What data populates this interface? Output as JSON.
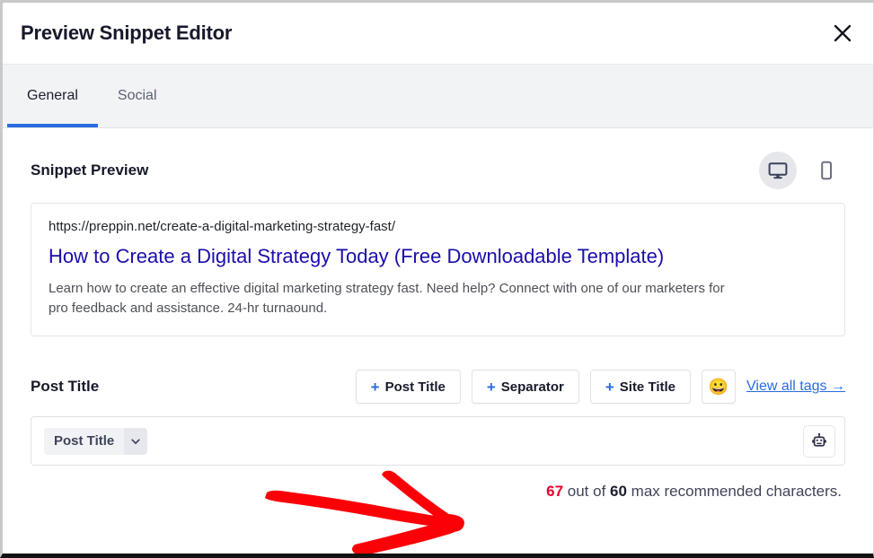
{
  "header": {
    "title": "Preview Snippet Editor",
    "close_icon": "close-icon"
  },
  "tabs": [
    {
      "label": "General",
      "active": true
    },
    {
      "label": "Social",
      "active": false
    }
  ],
  "preview_section": {
    "title": "Snippet Preview",
    "devices": [
      {
        "name": "desktop-icon",
        "label": "Desktop",
        "active": true
      },
      {
        "name": "mobile-icon",
        "label": "Mobile",
        "active": false
      }
    ],
    "snippet": {
      "url": "https://preppin.net/create-a-digital-marketing-strategy-fast/",
      "title": "How to Create a Digital Strategy Today (Free Downloadable Template)",
      "description": "Learn how to create an effective digital marketing strategy fast. Need help? Connect with one of our marketers for pro feedback and assistance. 24-hr turnaound."
    }
  },
  "field": {
    "label": "Post Title",
    "buttons": [
      {
        "plus": "+",
        "label": "Post Title"
      },
      {
        "plus": "+",
        "label": "Separator"
      },
      {
        "plus": "+",
        "label": "Site Title"
      }
    ],
    "emoji_button": "😀",
    "view_all_tags": "View all tags →",
    "chip": {
      "label": "Post Title",
      "caret_icon": "chevron-down-icon"
    },
    "ai_button_icon": "robot-icon"
  },
  "counter": {
    "count": "67",
    "middle": " out of ",
    "max": "60",
    "suffix": " max recommended characters."
  },
  "colors": {
    "accent_blue": "#2a6ce0",
    "link_blue": "#1a0dab",
    "over_limit_red": "#e3002b",
    "annotation_red": "#fb0007",
    "tab_bar_bg": "#f2f3f5",
    "title_navy": "#17192b"
  },
  "annotation": {
    "shape": "hand-drawn-arrow",
    "direction": "right",
    "color": "#fb0007"
  }
}
